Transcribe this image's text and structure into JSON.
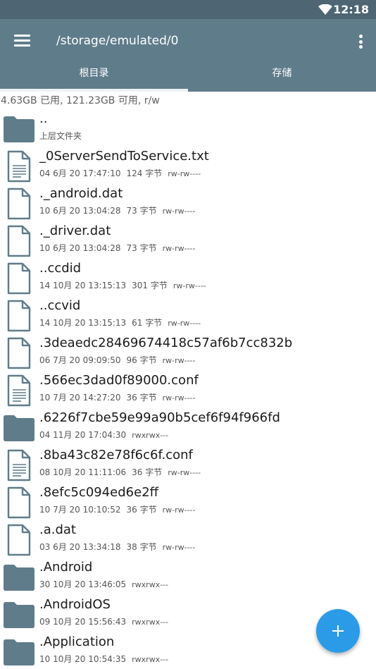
{
  "status_bar": {
    "time": "12:18",
    "wifi_icon": "wifi-icon"
  },
  "app_bar": {
    "path": "/storage/emulated/0",
    "menu_icon": "menu-icon",
    "more_icon": "more-vert-icon"
  },
  "tabs": [
    {
      "label": "根目录",
      "selected": true
    },
    {
      "label": "存储",
      "selected": false
    }
  ],
  "storage_info": "4.63GB 已用, 121.23GB 可用, r/w",
  "files": [
    {
      "type": "folder",
      "name": "..",
      "date": "上层文件夹",
      "size": "",
      "perm": ""
    },
    {
      "type": "text",
      "name": "_0ServerSendToService.txt",
      "date": "04 6月 20 17:47:10",
      "size": "124 字节",
      "perm": "rw-rw----"
    },
    {
      "type": "file",
      "name": "._android.dat",
      "date": "10 6月 20 13:04:28",
      "size": "73 字节",
      "perm": "rw-rw----"
    },
    {
      "type": "file",
      "name": "._driver.dat",
      "date": "10 6月 20 13:04:28",
      "size": "73 字节",
      "perm": "rw-rw----"
    },
    {
      "type": "file",
      "name": "..ccdid",
      "date": "14 10月 20 13:15:13",
      "size": "301 字节",
      "perm": "rw-rw----"
    },
    {
      "type": "file",
      "name": "..ccvid",
      "date": "14 10月 20 13:15:13",
      "size": "61 字节",
      "perm": "rw-rw----"
    },
    {
      "type": "file",
      "name": ".3deaedc28469674418c57af6b7cc832b",
      "date": "06 7月 20 09:09:50",
      "size": "96 字节",
      "perm": "rw-rw----"
    },
    {
      "type": "text",
      "name": ".566ec3dad0f89000.conf",
      "date": "10 7月 20 14:27:20",
      "size": "36 字节",
      "perm": "rw-rw----"
    },
    {
      "type": "folder",
      "name": ".6226f7cbe59e99a90b5cef6f94f966fd",
      "date": "04 11月 20 17:04:30",
      "size": "",
      "perm": "rwxrwx---"
    },
    {
      "type": "text",
      "name": ".8ba43c82e78f6c6f.conf",
      "date": "08 10月 20 11:11:06",
      "size": "36 字节",
      "perm": "rw-rw----"
    },
    {
      "type": "file",
      "name": ".8efc5c094ed6e2ff",
      "date": "10 7月 20 10:10:52",
      "size": "36 字节",
      "perm": "rw-rw----"
    },
    {
      "type": "file",
      "name": ".a.dat",
      "date": "03 6月 20 13:34:18",
      "size": "38 字节",
      "perm": "rw-rw----"
    },
    {
      "type": "folder",
      "name": ".Android",
      "date": "30 10月 20 13:46:05",
      "size": "",
      "perm": "rwxrwx---"
    },
    {
      "type": "folder",
      "name": ".AndroidOS",
      "date": "09 10月 20 15:56:43",
      "size": "",
      "perm": "rwxrwx---"
    },
    {
      "type": "folder",
      "name": ".Application",
      "date": "10 10月 20 10:54:35",
      "size": "",
      "perm": "rwxrwx---"
    }
  ],
  "fab": {
    "icon": "add-icon"
  },
  "colors": {
    "status_bar": "#4e6673",
    "app_bar": "#5f7c8b",
    "folder": "#5f7c8b",
    "fab": "#2b9be8"
  }
}
